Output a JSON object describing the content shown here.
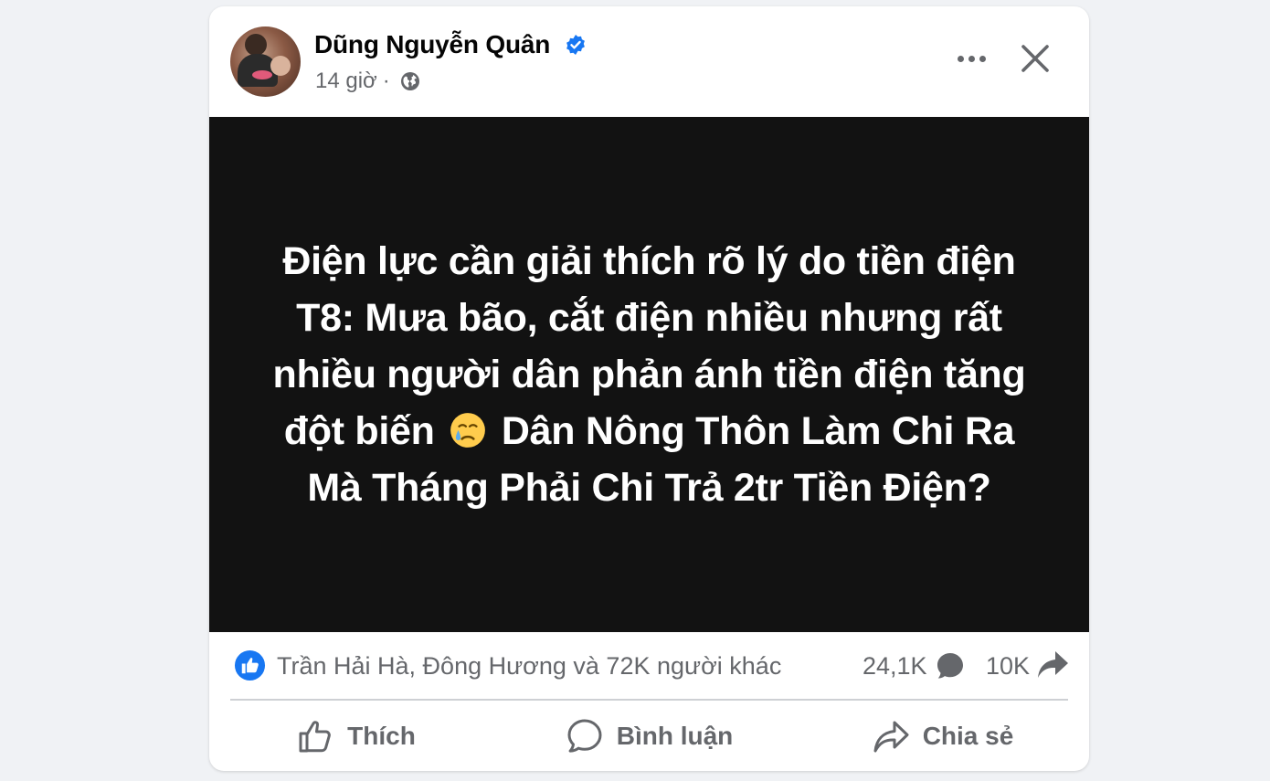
{
  "post": {
    "author_name": "Dũng Nguyễn Quân",
    "time": "14 giờ",
    "separator": "·",
    "text_before_emoji": "Điện lực cần giải thích rõ lý do tiền điện T8: Mưa bão, cắt điện nhiều nhưng rất nhiều người dân phản ánh tiền điện tăng đột biến",
    "text_after_emoji": "Dân Nông Thôn Làm Chi Ra Mà Tháng Phải Chi Trả 2tr Tiền Điện?",
    "emoji": "crying-face-icon",
    "image_background": "#121212"
  },
  "reactions": {
    "reactors": "Trần Hải Hà, Đông Hương và 72K người khác",
    "comment_count": "24,1K",
    "share_count": "10K"
  },
  "actions": {
    "like_label": "Thích",
    "comment_label": "Bình luận",
    "share_label": "Chia sẻ"
  },
  "colors": {
    "accent": "#1877f2",
    "secondary_text": "#65676b",
    "primary_text": "#050505"
  }
}
